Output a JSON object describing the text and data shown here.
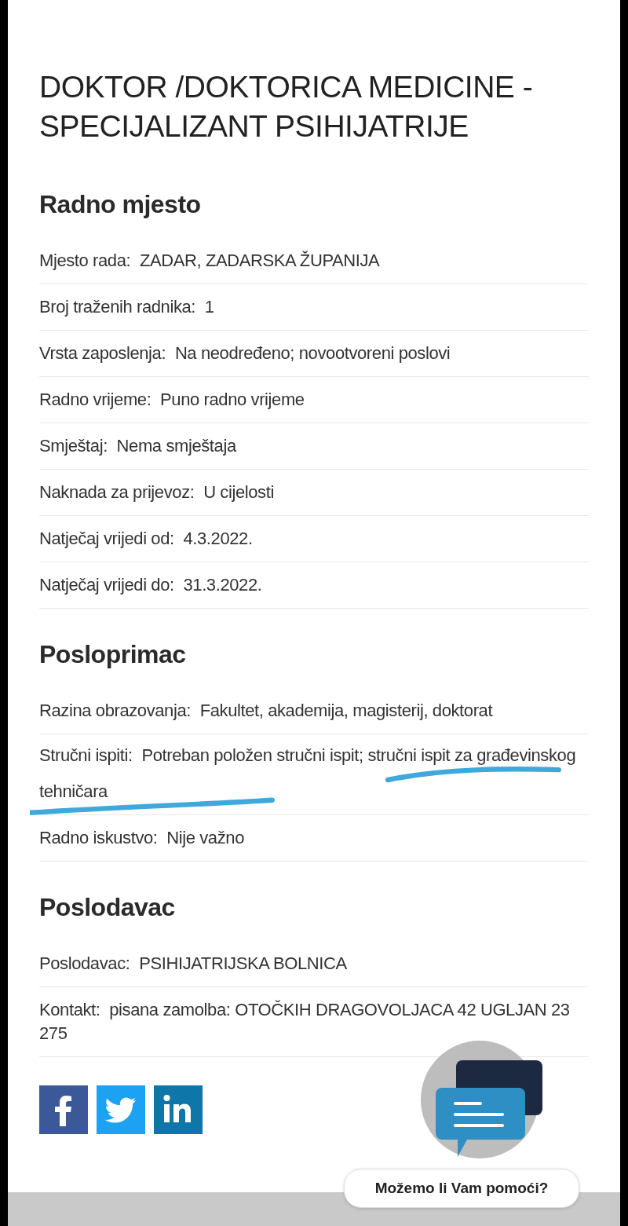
{
  "title": "DOKTOR /DOKTORICA MEDICINE - SPECIJALIZANT PSIHIJATRIJE",
  "sections": [
    {
      "heading": "Radno mjesto",
      "rows": [
        {
          "label": "Mjesto rada:",
          "value": "ZADAR, ZADARSKA ŽUPANIJA"
        },
        {
          "label": "Broj traženih radnika:",
          "value": "1"
        },
        {
          "label": "Vrsta zaposlenja:",
          "value": "Na neodređeno; novootvoreni poslovi"
        },
        {
          "label": "Radno vrijeme:",
          "value": "Puno radno vrijeme"
        },
        {
          "label": "Smještaj:",
          "value": "Nema smještaja"
        },
        {
          "label": "Naknada za prijevoz:",
          "value": "U cijelosti"
        },
        {
          "label": "Natječaj vrijedi od:",
          "value": "4.3.2022."
        },
        {
          "label": "Natječaj vrijedi do:",
          "value": "31.3.2022."
        }
      ]
    },
    {
      "heading": "Posloprimac",
      "rows": [
        {
          "label": "Razina obrazovanja:",
          "value": "Fakultet, akademija, magisterij, doktorat"
        },
        {
          "label": "Stručni ispiti:",
          "value": "Potreban položen stručni ispit; stručni ispit za građevinskog tehničara",
          "underlined": true
        },
        {
          "label": "Radno iskustvo:",
          "value": "Nije važno"
        }
      ]
    },
    {
      "heading": "Poslodavac",
      "rows": [
        {
          "label": "Poslodavac:",
          "value": "PSIHIJATRIJSKA BOLNICA"
        },
        {
          "label": "Kontakt:",
          "value": "pisana zamolba: OTOČKIH DRAGOVOLJACA 42 UGLJAN 23 275"
        }
      ]
    }
  ],
  "social": [
    {
      "kind": "facebook"
    },
    {
      "kind": "twitter"
    },
    {
      "kind": "linkedin"
    }
  ],
  "chat": {
    "button": "Možemo li Vam pomoći?"
  }
}
